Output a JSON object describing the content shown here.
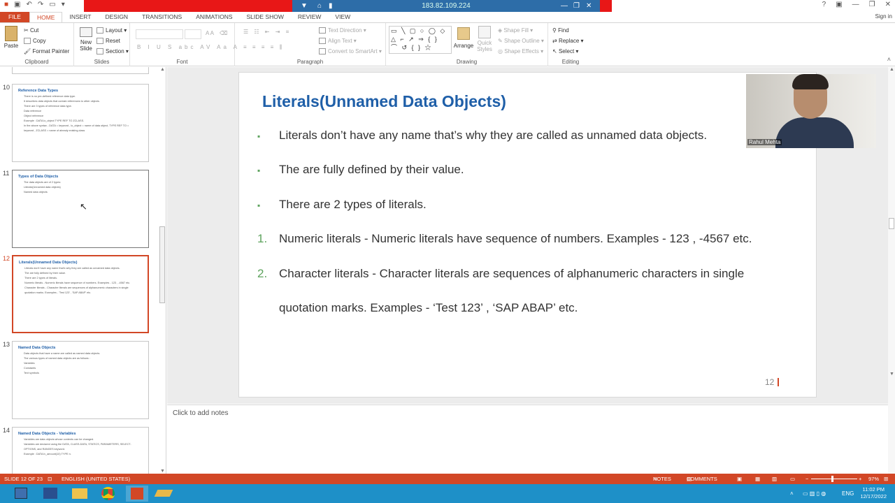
{
  "remote": {
    "ip": "183.82.109.224"
  },
  "account": {
    "signin": "Sign in"
  },
  "tabs": [
    "FILE",
    "HOME",
    "INSERT",
    "DESIGN",
    "TRANSITIONS",
    "ANIMATIONS",
    "SLIDE SHOW",
    "REVIEW",
    "VIEW"
  ],
  "ribbon": {
    "clipboard": {
      "paste": "Paste",
      "cut": "Cut",
      "copy": "Copy",
      "format_painter": "Format Painter",
      "name": "Clipboard"
    },
    "slides": {
      "new_slide": "New Slide",
      "layout": "Layout",
      "reset": "Reset",
      "section": "Section",
      "name": "Slides"
    },
    "font": {
      "name": "Font"
    },
    "paragraph": {
      "text_direction": "Text Direction",
      "align_text": "Align Text",
      "convert_smartart": "Convert to SmartArt",
      "name": "Paragraph"
    },
    "drawing": {
      "arrange": "Arrange",
      "quick_styles": "Quick Styles",
      "shape_fill": "Shape Fill",
      "shape_outline": "Shape Outline",
      "shape_effects": "Shape Effects",
      "name": "Drawing"
    },
    "editing": {
      "find": "Find",
      "replace": "Replace",
      "select": "Select",
      "name": "Editing"
    }
  },
  "thumbnails": [
    {
      "num": "10",
      "title": "Reference Data Types",
      "lines": [
        "There is no pre-defined reference data type.",
        "It describes data objects that contain references to other objects.",
        "There are 3 types of reference data type.",
        "Data reference",
        "Object reference",
        "Example : DATA lo_object TYPE REF TO ZCLASS.",
        "In the above syntax - DATA = keyword , lo_object = name of data object, TYPE REF TO =",
        "keyword , ZCLASS = name of already existing class"
      ]
    },
    {
      "num": "11",
      "title": "Types of Data Objects",
      "lines": [
        "The data objects are of 2 types:",
        "Literals(Unnamed data objects)",
        "Named data objects"
      ]
    },
    {
      "num": "12",
      "title": "Literals(Unnamed Data Objects)",
      "lines": [
        "Literals don't have any name that's why they are called as unnamed data objects.",
        "The are fully defined by their value.",
        "There are 2 types of literals.",
        "Numeric literals - Numeric literals have sequence of numbers. Examples - 123 , -4567 etc.",
        "Character literals - Character literals are sequences of alphanumeric characters in single",
        "quotation marks. Examples - 'Test 123' , 'SAP ABAP' etc."
      ]
    },
    {
      "num": "13",
      "title": "Named Data Objects",
      "lines": [
        "Data objects that have a name are called as named data objects.",
        "The various types of named data objects are as follows :",
        "Variables",
        "Constants",
        "Text symbols"
      ]
    },
    {
      "num": "14",
      "title": "Named Data Objects - Variables",
      "lines": [
        "Variables are data objects whose contents can be changed.",
        "Variables are declared using the DATA, CLASS-DATA, STATICS, PARAMETERS, SELECT-",
        "OPTIONS, and RANGES keyword.",
        "Example : DATA lv_amount(10) TYPE n."
      ]
    }
  ],
  "slide": {
    "title": "Literals(Unnamed Data Objects)",
    "bullets": [
      "Literals don’t have any name that’s why they are called as unnamed data objects.",
      "The are fully defined by their value.",
      "There are 2 types of literals."
    ],
    "numbered": [
      {
        "num": "1.",
        "text": "Numeric literals - Numeric literals have sequence of numbers. Examples - 123 , -4567 etc."
      },
      {
        "num": "2.",
        "text": "Character literals - Character literals are sequences of alphanumeric characters in single"
      }
    ],
    "continuation": "quotation marks. Examples - ‘Test 123’ ,  ‘SAP ABAP’ etc.",
    "page_number": "12"
  },
  "webcam": {
    "name": "Rahul Mehta"
  },
  "notes": {
    "placeholder": "Click to add notes"
  },
  "status": {
    "slide": "SLIDE 12 OF 23",
    "language": "ENGLISH (UNITED STATES)",
    "notes": "NOTES",
    "comments": "COMMENTS",
    "zoom": "97%"
  },
  "tray": {
    "lang": "ENG",
    "time": "11:02 PM",
    "date": "12/17/2022"
  },
  "colors": {
    "accent": "#d24726",
    "title": "#1f5fa8",
    "bullet": "#5ea35e",
    "taskbar": "#1e90c8"
  }
}
